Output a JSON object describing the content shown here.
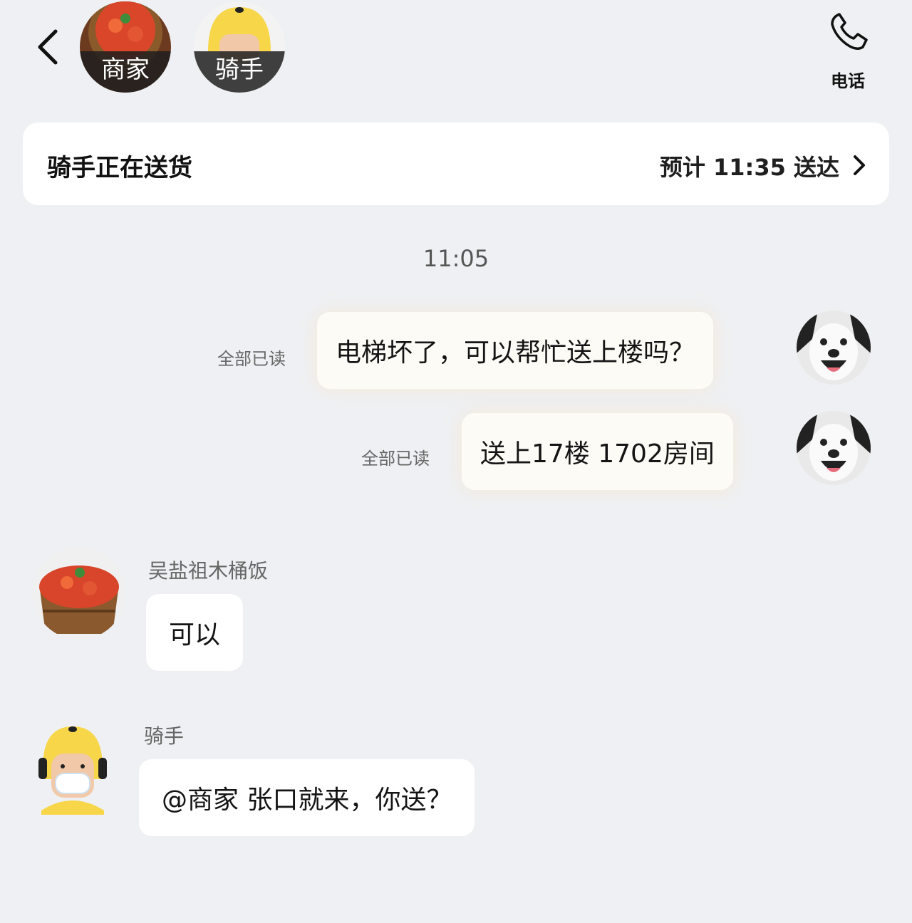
{
  "header": {
    "merchant_label": "商家",
    "rider_label": "骑手",
    "phone_label": "电话"
  },
  "status": {
    "text": "骑手正在送货",
    "eta": "预计 11:35 送达"
  },
  "chat": {
    "timestamp": "11:05",
    "messages": [
      {
        "text": "电梯坏了，可以帮忙送上楼吗？",
        "read": "全部已读"
      },
      {
        "text": "送上17楼  1702房间",
        "read": "全部已读"
      },
      {
        "sender": "吴盐祖木桶饭",
        "text": "可以"
      },
      {
        "sender": "骑手",
        "text": "@商家  张口就来，你送？"
      }
    ]
  },
  "colors": {
    "background": "#eff0f3",
    "rider_yellow": "#f7d64a",
    "bubble_self": "#fdfbf5"
  },
  "icons": [
    "back-icon",
    "phone-icon",
    "chevron-right-icon"
  ]
}
